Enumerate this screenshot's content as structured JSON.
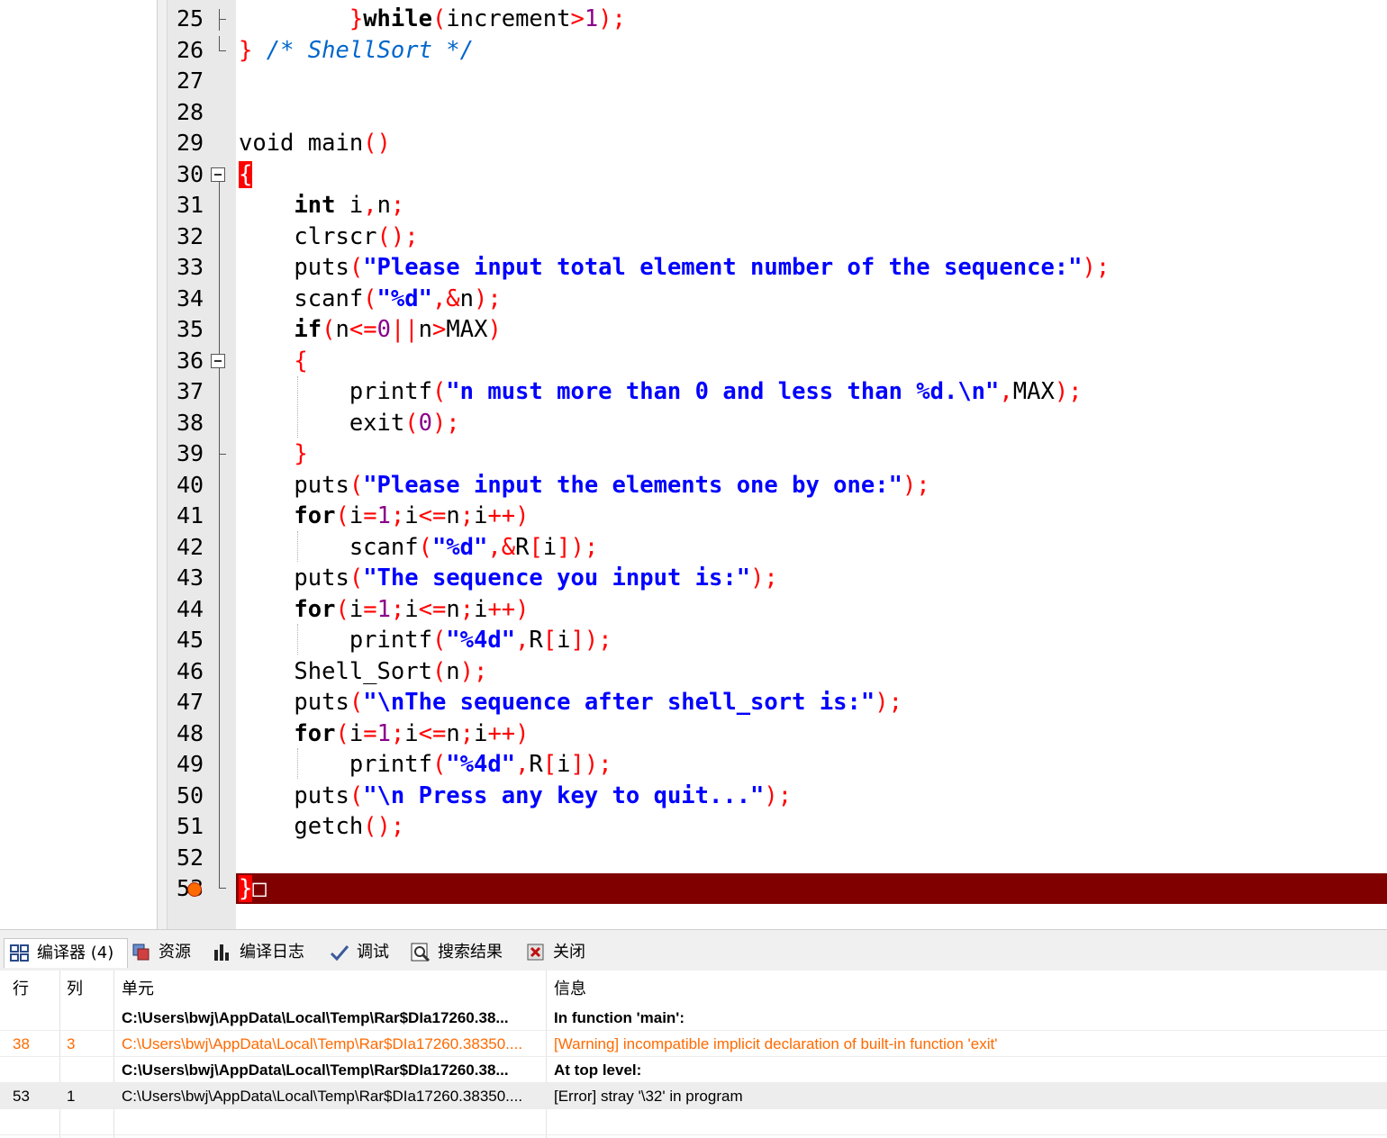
{
  "editor": {
    "lines": [
      {
        "no": "25",
        "html": "        <span class=\"p\">}</span><span class=\"kw\">while</span><span class=\"p\">(</span>increment<span class=\"p\">&gt;</span><span class=\"n\">1</span><span class=\"p\">);</span>"
      },
      {
        "no": "26",
        "html": "<span class=\"p\">}</span> <span class=\"c\">/* ShellSort */</span>"
      },
      {
        "no": "27",
        "html": ""
      },
      {
        "no": "28",
        "html": ""
      },
      {
        "no": "29",
        "html": "void main<span class=\"p\">()</span>"
      },
      {
        "no": "30",
        "html": "<span class=\"brace-hl\">{</span>"
      },
      {
        "no": "31",
        "html": "    <span class=\"kw\">int</span> i<span class=\"p\">,</span>n<span class=\"p\">;</span>"
      },
      {
        "no": "32",
        "html": "    clrscr<span class=\"p\">();</span>"
      },
      {
        "no": "33",
        "html": "    puts<span class=\"p\">(</span><span class=\"s\">\"Please input total element number of the sequence:\"</span><span class=\"p\">);</span>"
      },
      {
        "no": "34",
        "html": "    scanf<span class=\"p\">(</span><span class=\"s\">\"%d\"</span><span class=\"p\">,&amp;</span>n<span class=\"p\">);</span>"
      },
      {
        "no": "35",
        "html": "    <span class=\"kw\">if</span><span class=\"p\">(</span>n<span class=\"p\">&lt;=</span><span class=\"n\">0</span><span class=\"p\">||</span>n<span class=\"p\">&gt;</span>MAX<span class=\"p\">)</span>"
      },
      {
        "no": "36",
        "html": "    <span class=\"p\">{</span>"
      },
      {
        "no": "37",
        "html": "        printf<span class=\"p\">(</span><span class=\"s\">\"n must more than 0 and less than %d.\\n\"</span><span class=\"p\">,</span>MAX<span class=\"p\">);</span>"
      },
      {
        "no": "38",
        "html": "        exit<span class=\"p\">(</span><span class=\"n\">0</span><span class=\"p\">);</span>"
      },
      {
        "no": "39",
        "html": "    <span class=\"p\">}</span>"
      },
      {
        "no": "40",
        "html": "    puts<span class=\"p\">(</span><span class=\"s\">\"Please input the elements one by one:\"</span><span class=\"p\">);</span>"
      },
      {
        "no": "41",
        "html": "    <span class=\"kw\">for</span><span class=\"p\">(</span>i<span class=\"p\">=</span><span class=\"n\">1</span><span class=\"p\">;</span>i<span class=\"p\">&lt;=</span>n<span class=\"p\">;</span>i<span class=\"p\">++)</span>"
      },
      {
        "no": "42",
        "html": "        scanf<span class=\"p\">(</span><span class=\"s\">\"%d\"</span><span class=\"p\">,&amp;</span>R<span class=\"p\">[</span>i<span class=\"p\">]);</span>"
      },
      {
        "no": "43",
        "html": "    puts<span class=\"p\">(</span><span class=\"s\">\"The sequence you input is:\"</span><span class=\"p\">);</span>"
      },
      {
        "no": "44",
        "html": "    <span class=\"kw\">for</span><span class=\"p\">(</span>i<span class=\"p\">=</span><span class=\"n\">1</span><span class=\"p\">;</span>i<span class=\"p\">&lt;=</span>n<span class=\"p\">;</span>i<span class=\"p\">++)</span>"
      },
      {
        "no": "45",
        "html": "        printf<span class=\"p\">(</span><span class=\"s\">\"%4d\"</span><span class=\"p\">,</span>R<span class=\"p\">[</span>i<span class=\"p\">]);</span>"
      },
      {
        "no": "46",
        "html": "    Shell_Sort<span class=\"p\">(</span>n<span class=\"p\">);</span>"
      },
      {
        "no": "47",
        "html": "    puts<span class=\"p\">(</span><span class=\"s\">\"\\nThe sequence after shell_sort is:\"</span><span class=\"p\">);</span>"
      },
      {
        "no": "48",
        "html": "    <span class=\"kw\">for</span><span class=\"p\">(</span>i<span class=\"p\">=</span><span class=\"n\">1</span><span class=\"p\">;</span>i<span class=\"p\">&lt;=</span>n<span class=\"p\">;</span>i<span class=\"p\">++)</span>"
      },
      {
        "no": "49",
        "html": "        printf<span class=\"p\">(</span><span class=\"s\">\"%4d\"</span><span class=\"p\">,</span>R<span class=\"p\">[</span>i<span class=\"p\">]);</span>"
      },
      {
        "no": "50",
        "html": "    puts<span class=\"p\">(</span><span class=\"s\">\"\\n Press any key to quit...\"</span><span class=\"p\">);</span>"
      },
      {
        "no": "51",
        "html": "    getch<span class=\"p\">();</span>"
      },
      {
        "no": "52",
        "html": ""
      },
      {
        "no": "53",
        "html": "<span class=\"brace-hl\">}</span><span style=\"color:#fff\">&#9633;</span>"
      }
    ]
  },
  "tabs": [
    {
      "label": "编译器 (4)",
      "icon": "compiler-icon",
      "name": "tab-compiler",
      "active": true
    },
    {
      "label": "资源",
      "icon": "resources-icon",
      "name": "tab-resources"
    },
    {
      "label": "编译日志",
      "icon": "compile-log-icon",
      "name": "tab-compile-log"
    },
    {
      "label": "调试",
      "icon": "debug-icon",
      "name": "tab-debug"
    },
    {
      "label": "搜索结果",
      "icon": "search-results-icon",
      "name": "tab-search-results"
    },
    {
      "label": "关闭",
      "icon": "close-icon",
      "name": "tab-close"
    }
  ],
  "messages": {
    "headers": {
      "line": "行",
      "col": "列",
      "unit": "单元",
      "message": "信息"
    },
    "rows": [
      {
        "line": "",
        "col": "",
        "unit": "C:\\Users\\bwj\\AppData\\Local\\Temp\\Rar$DIa17260.38...",
        "message": "In function 'main':",
        "style": "bold"
      },
      {
        "line": "38",
        "col": "3",
        "unit": "C:\\Users\\bwj\\AppData\\Local\\Temp\\Rar$DIa17260.38350....",
        "message": "[Warning] incompatible implicit declaration of built-in function 'exit'",
        "style": "warn"
      },
      {
        "line": "",
        "col": "",
        "unit": "C:\\Users\\bwj\\AppData\\Local\\Temp\\Rar$DIa17260.38...",
        "message": "At top level:",
        "style": "bold"
      },
      {
        "line": "53",
        "col": "1",
        "unit": "C:\\Users\\bwj\\AppData\\Local\\Temp\\Rar$DIa17260.38350....",
        "message": "[Error] stray '\\32' in program",
        "style": "selected"
      }
    ]
  },
  "colors": {
    "error_line": "#800000",
    "warning_text": "#ff6a00",
    "string": "#0000ff",
    "punct": "#ff0000",
    "comment": "#0066cc"
  }
}
